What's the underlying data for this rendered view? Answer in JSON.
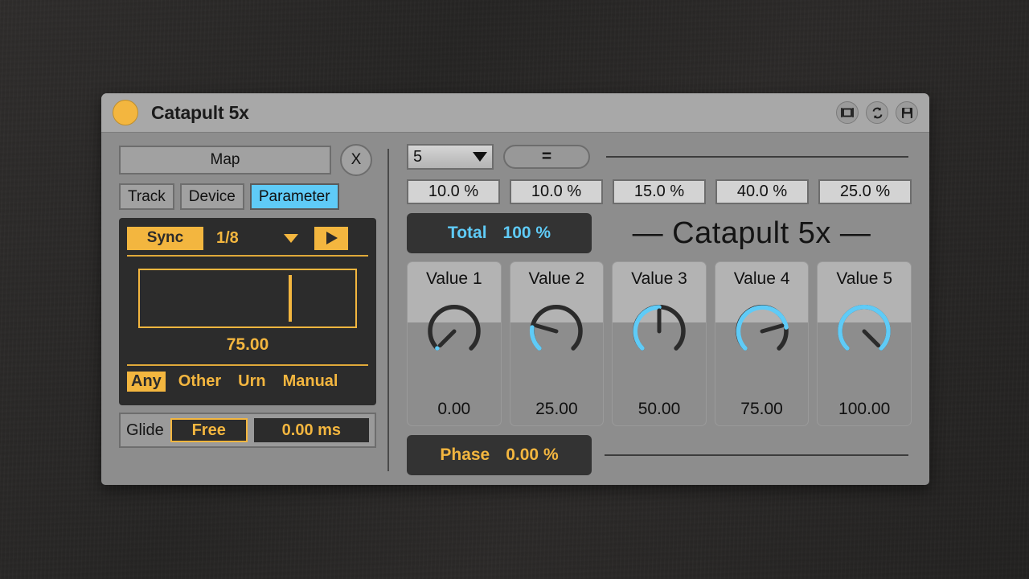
{
  "window": {
    "title": "Catapult 5x",
    "icons": [
      {
        "name": "map-icon",
        "glyph": "map"
      },
      {
        "name": "refresh-icon",
        "glyph": "refresh"
      },
      {
        "name": "save-icon",
        "glyph": "save"
      }
    ]
  },
  "left": {
    "map_label": "Map",
    "close_label": "X",
    "target_buttons": [
      {
        "label": "Track",
        "active": false
      },
      {
        "label": "Device",
        "active": false
      },
      {
        "label": "Parameter",
        "active": true
      }
    ],
    "lfo": {
      "sync_label": "Sync",
      "rate": "1/8",
      "play_label": "play-icon",
      "value": "75.00",
      "phase_position_pct": 69,
      "modes": [
        {
          "label": "Any",
          "active": true
        },
        {
          "label": "Other",
          "active": false
        },
        {
          "label": "Urn",
          "active": false
        },
        {
          "label": "Manual",
          "active": false
        }
      ]
    },
    "glide": {
      "label": "Glide",
      "mode": "Free",
      "time": "0.00 ms"
    }
  },
  "right": {
    "steps_select": "5",
    "equalize_label": "=",
    "percentages": [
      "10.0 %",
      "10.0 %",
      "15.0 %",
      "40.0 %",
      "25.0 %"
    ],
    "total": {
      "label": "Total",
      "value": "100 %"
    },
    "brand": "— Catapult 5x —",
    "values": [
      {
        "label": "Value 1",
        "value": "0.00",
        "pct": 0
      },
      {
        "label": "Value 2",
        "value": "25.00",
        "pct": 25
      },
      {
        "label": "Value 3",
        "value": "50.00",
        "pct": 50
      },
      {
        "label": "Value 4",
        "value": "75.00",
        "pct": 75
      },
      {
        "label": "Value 5",
        "value": "100.00",
        "pct": 100
      }
    ],
    "phase": {
      "label": "Phase",
      "value": "0.00 %"
    }
  },
  "colors": {
    "accent_orange": "#f3b63f",
    "accent_blue": "#5fcbf7",
    "panel_gray": "#8d8d8d",
    "dark_panel": "#2c2c2c",
    "knob_track": "#2b2b2b"
  }
}
